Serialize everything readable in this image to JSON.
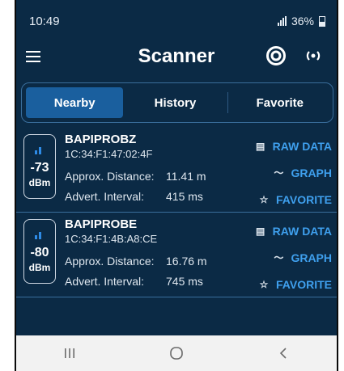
{
  "status_bar": {
    "time": "10:49",
    "battery": "36%"
  },
  "app_bar": {
    "title": "Scanner"
  },
  "tabs": [
    {
      "label": "Nearby"
    },
    {
      "label": "History"
    },
    {
      "label": "Favorite"
    }
  ],
  "devices": [
    {
      "name": "BAPIPROBZ",
      "mac": "1C:34:F1:47:02:4F",
      "rssi": "-73",
      "rssi_unit": "dBm",
      "distance_label": "Approx. Distance:",
      "distance": "11.41 m",
      "interval_label": "Advert. Interval:",
      "interval": "415 ms"
    },
    {
      "name": "BAPIPROBE",
      "mac": "1C:34:F1:4B:A8:CE",
      "rssi": "-80",
      "rssi_unit": "dBm",
      "distance_label": "Approx. Distance:",
      "distance": "16.76 m",
      "interval_label": "Advert. Interval:",
      "interval": "745 ms"
    }
  ],
  "actions": {
    "raw": "RAW DATA",
    "graph": "GRAPH",
    "favorite": "FAVORITE"
  },
  "colors": {
    "background": "#0b2a45",
    "accent": "#3fa0ee",
    "active_tab": "#1a5f9e"
  }
}
